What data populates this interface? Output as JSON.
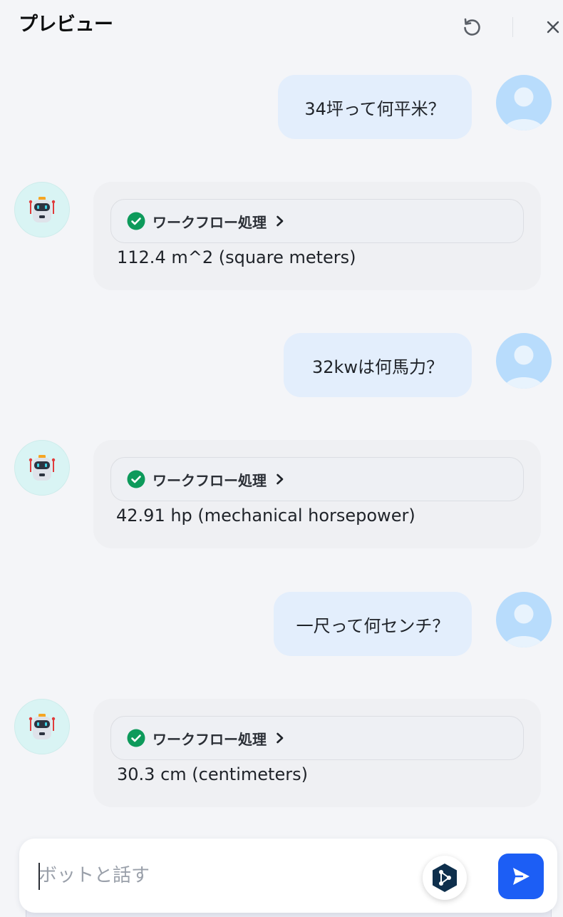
{
  "header": {
    "title": "プレビュー"
  },
  "messages": [
    {
      "role": "user",
      "text": "34坪って何平米？"
    },
    {
      "role": "bot",
      "workflow_label": "ワークフロー処理",
      "status": "success",
      "answer": "112.4 m^2 (square meters)"
    },
    {
      "role": "user",
      "text": "32kwは何馬力？"
    },
    {
      "role": "bot",
      "workflow_label": "ワークフロー処理",
      "status": "success",
      "answer": "42.91 hp (mechanical horsepower)"
    },
    {
      "role": "user",
      "text": "一尺って何センチ？"
    },
    {
      "role": "bot",
      "workflow_label": "ワークフロー処理",
      "status": "success",
      "answer": "30.3 cm (centimeters)"
    }
  ],
  "composer": {
    "placeholder": "ボットと話す",
    "value": ""
  },
  "icons": {
    "reset": "reset-icon",
    "close": "close-icon",
    "check": "check-circle-icon",
    "chevron": "chevron-right-icon",
    "plugin": "workflow-plugin-icon",
    "send": "send-icon"
  },
  "colors": {
    "accent": "#1c5ef5",
    "success": "#0d9a5b",
    "user_bubble": "#e3eefc",
    "bot_bubble": "#eff0f3",
    "user_avatar": "#b8dcfc",
    "bot_avatar": "#d9f4f4"
  }
}
